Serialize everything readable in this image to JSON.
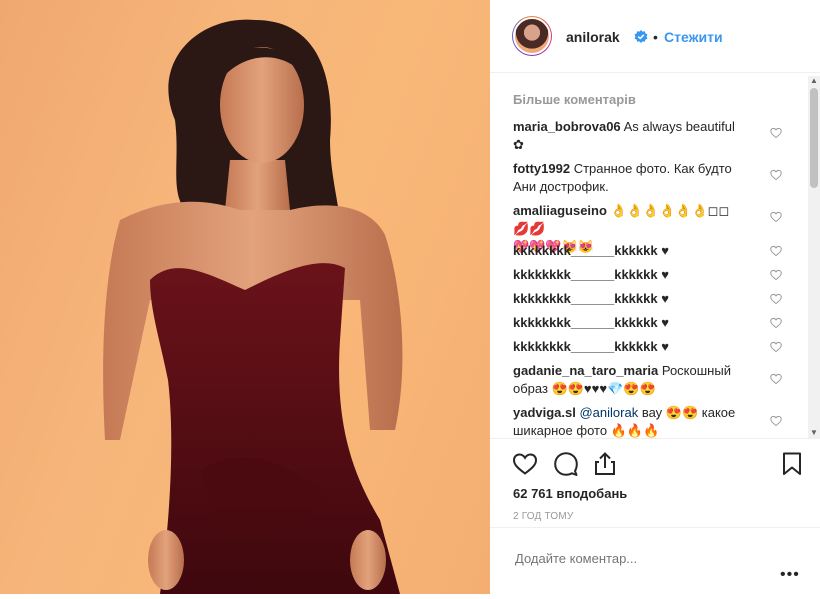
{
  "post": {
    "username": "anilorak",
    "separator": "•",
    "follow_label": "Стежити"
  },
  "comments": {
    "load_more": "Більше коментарів",
    "items": [
      {
        "user": "maria_bobrova06",
        "text": " As always beautiful",
        "line2": "✿"
      },
      {
        "user": "fotty1992",
        "text": " Странное фото. Как будто",
        "line2": "Ани дострофик."
      },
      {
        "user": "amaliiaguseino",
        "text": " 👌👌👌👌👌👌◻◻💋💋",
        "line2": "💖💖💖😻😻"
      },
      {
        "user": "kkkkkkkk______kkkkkk",
        "text": " ♥"
      },
      {
        "user": "kkkkkkkk______kkkkkk",
        "text": " ♥"
      },
      {
        "user": "kkkkkkkk______kkkkkk",
        "text": " ♥"
      },
      {
        "user": "kkkkkkkk______kkkkkk",
        "text": " ♥"
      },
      {
        "user": "kkkkkkkk______kkkkkk",
        "text": " ♥"
      },
      {
        "user": "gadanie_na_taro_maria",
        "text": " Роскошный",
        "line2": "образ 😍😍♥♥♥💎😍😍"
      },
      {
        "user": "yadviga.sl",
        "mention": " @anilorak",
        "text": " вау 😍😍 какое",
        "line2": "шикарное фото 🔥🔥🔥"
      }
    ]
  },
  "actions": {
    "likes": "62 761 вподобань",
    "time": "2 ГОД ТОМУ",
    "comment_placeholder": "Додайте коментар...",
    "more": "•••"
  },
  "colors": {
    "accent": "#3897f0",
    "muted": "#999999",
    "text": "#262626",
    "dress": "#5a0d14"
  }
}
